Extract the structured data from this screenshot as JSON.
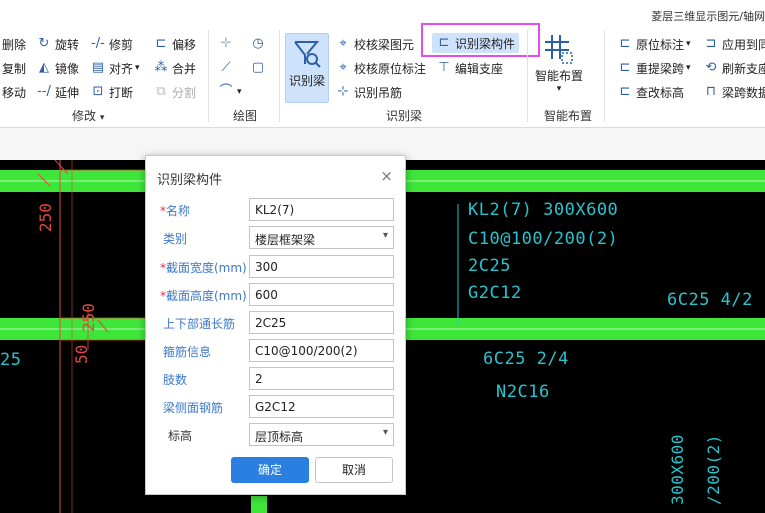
{
  "title_strip": "菱层三维显示图元/轴网",
  "modify": {
    "delete": "删除",
    "rotate": "旋转",
    "trim": "修剪",
    "offset": "偏移",
    "copy": "复制",
    "mirror": "镜像",
    "align": "对齐",
    "merge": "合并",
    "move": "移动",
    "extend": "延伸",
    "break": "打断",
    "split": "分割",
    "group_label": "修改"
  },
  "draw": {
    "group_label": "绘图"
  },
  "identify_beam": {
    "big_button": "识别梁",
    "check_beam_elements": "校核梁图元",
    "identify_beam_component": "识别梁构件",
    "check_origin_annotation": "校核原位标注",
    "edit_support": "编辑支座",
    "identify_hanging_bar": "识别吊筋",
    "group_label": "识别梁"
  },
  "smart_layout": {
    "big_button": "智能布置",
    "group_label": "智能布置"
  },
  "right_group": {
    "origin_annotation": "原位标注",
    "apply_to": "应用到同",
    "re_extract_span": "重提梁跨",
    "refresh_support": "刷新支座",
    "change_elevation": "查改标高",
    "beam_span_data": "梁跨数据"
  },
  "cad": {
    "label_kl2": "KL2(7) 300X600",
    "label_stirrup": "C10@100/200(2)",
    "label_2c25": "2C25",
    "label_g2c12": "G2C12",
    "label_6c25_42": "6C25 4/2",
    "label_6c25_24": "6C25 2/4",
    "label_n2c16": "N2C16",
    "label_25": "25",
    "label_300x600_v": "300X600",
    "label_200_v": "/200(2)",
    "dim_250_a": "250",
    "dim_250_b": "250",
    "dim_50": "50"
  },
  "dialog": {
    "title": "识别梁构件",
    "close": "×",
    "fields": [
      {
        "label": "名称",
        "required": true,
        "value": "KL2(7)",
        "type": "input"
      },
      {
        "label": "类别",
        "required": false,
        "value": "楼层框架梁",
        "type": "select"
      },
      {
        "label": "截面宽度(mm)",
        "required": true,
        "value": "300",
        "type": "input"
      },
      {
        "label": "截面高度(mm)",
        "required": true,
        "value": "600",
        "type": "input"
      },
      {
        "label": "上下部通长筋",
        "required": false,
        "value": "2C25",
        "type": "input"
      },
      {
        "label": "箍筋信息",
        "required": false,
        "value": "C10@100/200(2)",
        "type": "input"
      },
      {
        "label": "肢数",
        "required": false,
        "value": "2",
        "type": "input"
      },
      {
        "label": "梁侧面钢筋",
        "required": false,
        "value": "G2C12",
        "type": "input"
      },
      {
        "label": "标高",
        "required": false,
        "value": "层顶标高",
        "type": "select"
      }
    ],
    "ok": "确定",
    "cancel": "取消"
  },
  "colors": {
    "cad_background": "#000000",
    "beam_green": "#3ee63a",
    "annotation_cyan": "#27c4cf",
    "dimension_red": "#e0473d",
    "highlight_magenta": "#e14ee9",
    "primary_button": "#2a7fe0"
  }
}
